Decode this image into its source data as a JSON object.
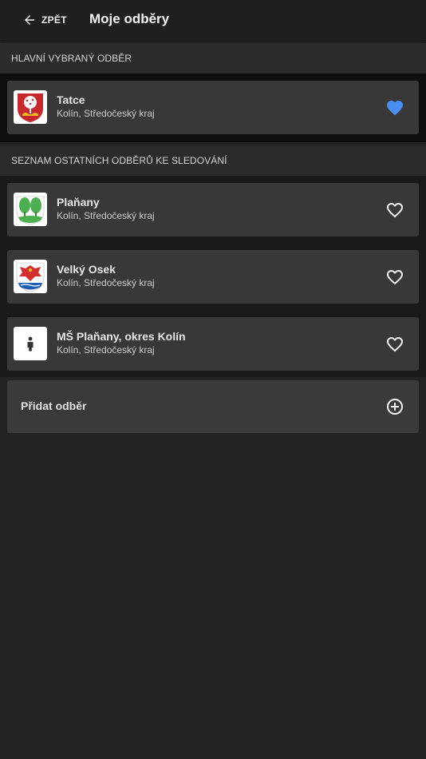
{
  "header": {
    "back_label": "ZPĚT",
    "title": "Moje odběry"
  },
  "main_section": {
    "title": "HLAVNÍ VYBRANÝ ODBĚR",
    "item": {
      "name": "Tatce",
      "location": "Kolín, Středočeský kraj",
      "favorite": true,
      "logo_icon": "tatce-coat-of-arms-icon"
    }
  },
  "others_section": {
    "title": "SEZNAM OSTATNÍCH ODBĚRŮ KE SLEDOVÁNÍ",
    "items": [
      {
        "name": "Plaňany",
        "location": "Kolín, Středočeský kraj",
        "favorite": false,
        "logo_icon": "planany-coat-of-arms-icon"
      },
      {
        "name": "Velký Osek",
        "location": "Kolín, Středočeský kraj",
        "favorite": false,
        "logo_icon": "velky-osek-coat-of-arms-icon"
      },
      {
        "name": "MŠ Plaňany, okres Kolín",
        "location": "Kolín, Středočeský kraj",
        "favorite": false,
        "logo_icon": "child-icon"
      }
    ]
  },
  "add_subscription": {
    "label": "Přidat odběr"
  },
  "colors": {
    "background": "#232323",
    "card": "#383838",
    "accent_heart": "#4a8df0",
    "section_header": "#2b2b2b"
  }
}
